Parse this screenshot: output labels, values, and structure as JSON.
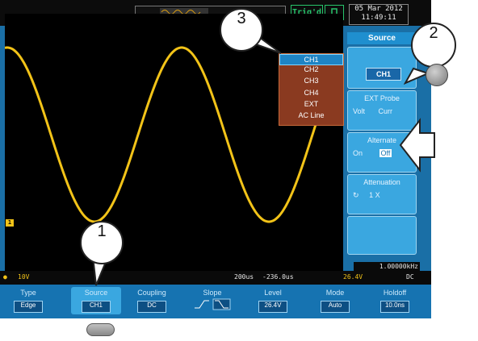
{
  "topbar": {
    "trigger_status": "Trig'd",
    "date": "05 Mar 2012",
    "time": "11:49:11"
  },
  "side_menu": {
    "header": "Source",
    "source_value": "CH1",
    "ext_probe": {
      "title": "EXT Probe",
      "options": [
        "Volt",
        "Curr"
      ]
    },
    "alternate": {
      "title": "Alternate",
      "options": [
        "On",
        "Off"
      ]
    },
    "attenuation": {
      "title": "Attenuation",
      "value": "1 X"
    }
  },
  "source_dropdown": {
    "options": [
      "CH1",
      "CH2",
      "CH3",
      "CH4",
      "EXT",
      "AC Line"
    ],
    "selected": "CH1"
  },
  "statusbar": {
    "ch1_scale": "10V",
    "timebase": "200us",
    "delay": "-236.0us",
    "trigger_level": "26.4V",
    "coupling": "DC",
    "frequency": "1.00000kHz"
  },
  "bottom_menu": [
    {
      "label": "Type",
      "value": "Edge"
    },
    {
      "label": "Source",
      "value": "CH1"
    },
    {
      "label": "Coupling",
      "value": "DC"
    },
    {
      "label": "Slope",
      "value": ""
    },
    {
      "label": "Level",
      "value": "26.4V"
    },
    {
      "label": "Mode",
      "value": "Auto"
    },
    {
      "label": "Holdoff",
      "value": "10.0ns"
    }
  ],
  "callouts": [
    "1",
    "2",
    "3"
  ],
  "colors": {
    "trace": "#f2c318",
    "accent": "#1f8fcf",
    "trigger": "#27c46b"
  }
}
